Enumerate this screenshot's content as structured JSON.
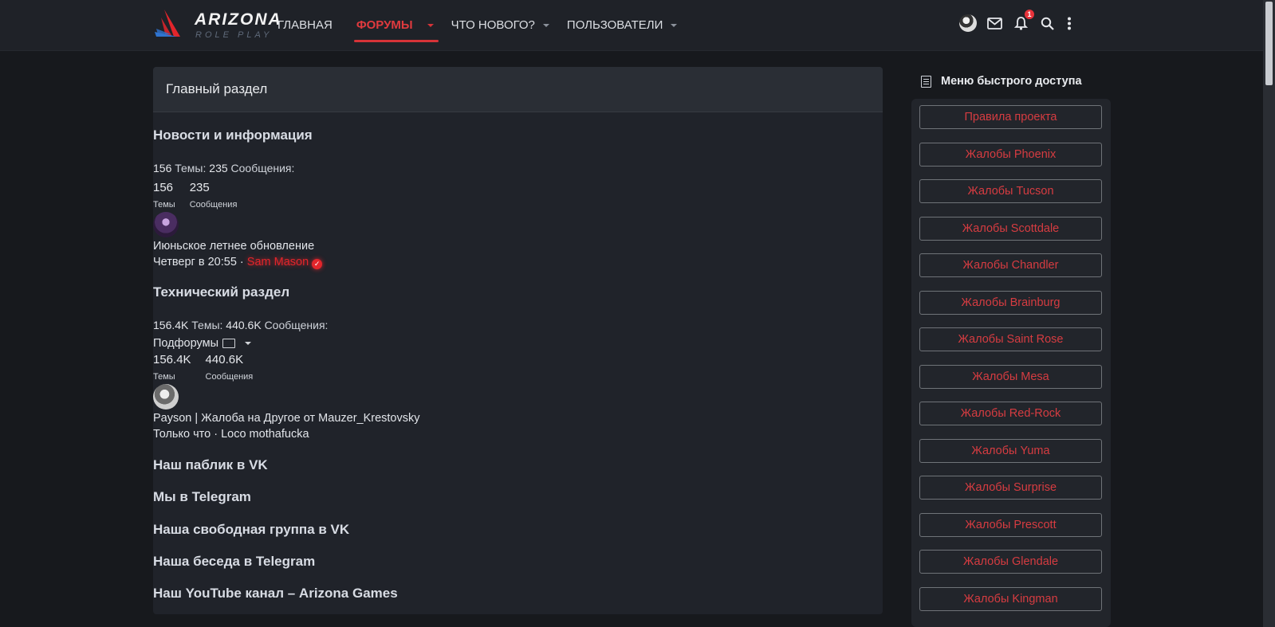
{
  "header": {
    "logo": {
      "title": "ARIZONA",
      "subtitle": "ROLE PLAY"
    },
    "nav": [
      {
        "label": "ГЛАВНАЯ",
        "active": false,
        "dropdown": false
      },
      {
        "label": "ФОРУМЫ",
        "active": true,
        "dropdown": true
      },
      {
        "label": "ЧТО НОВОГО?",
        "active": false,
        "dropdown": true
      },
      {
        "label": "ПОЛЬЗОВАТЕЛИ",
        "active": false,
        "dropdown": true
      }
    ],
    "icons": {
      "avatar": "user-avatar",
      "messages": "mail-icon",
      "alerts": "bell-icon",
      "alerts_count": "1",
      "search": "search-icon",
      "more": "more-vertical-icon"
    }
  },
  "main": {
    "title": "Главный раздел",
    "forums": [
      {
        "title": "Новости и информация",
        "threads": "156",
        "messages": "235",
        "threads_label": "Темы:",
        "messages_label": "Сообщения:",
        "threads_label_short": "Темы",
        "messages_label_short": "Сообщения",
        "last_post_title": "Июньское летнее обновление",
        "last_post_time": "Четверг в 20:55",
        "separator": " · ",
        "last_post_author": "Sam Mason"
      },
      {
        "title": "Технический раздел",
        "threads": "156.4K",
        "messages": "440.6K",
        "threads_label": "Темы:",
        "messages_label": "Сообщения:",
        "threads_label_short": "Темы",
        "messages_label_short": "Сообщения",
        "subforums_label": "Подфорумы",
        "last_post_title": "Payson | Жалоба на Другое от Mauzer_Krestovsky",
        "last_post_time": "Только что",
        "separator": " · ",
        "last_post_author": "Loco mothafucka"
      }
    ],
    "links": [
      "Наш паблик в VK",
      "Мы в Telegram",
      "Наша свободная группа в VK",
      "Наша беседа в Telegram",
      "Наш YouTube канал – Arizona Games"
    ]
  },
  "sidebar": {
    "title": "Меню быстрого доступа",
    "buttons": [
      "Правила проекта",
      "Жалобы Phoenix",
      "Жалобы Tucson",
      "Жалобы Scottdale",
      "Жалобы Chandler",
      "Жалобы Brainburg",
      "Жалобы Saint Rose",
      "Жалобы Mesa",
      "Жалобы Red-Rock",
      "Жалобы Yuma",
      "Жалобы Surprise",
      "Жалобы Prescott",
      "Жалобы Glendale",
      "Жалобы Kingman"
    ]
  },
  "colors": {
    "accent": "#d63338",
    "background": "#17191d",
    "panel": "#20232a"
  }
}
